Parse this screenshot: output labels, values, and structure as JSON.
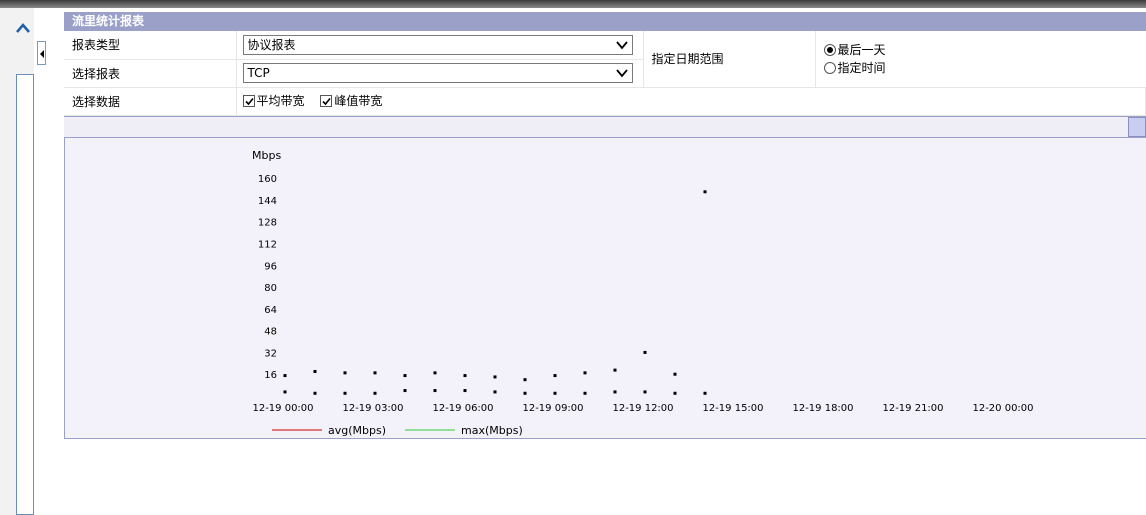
{
  "panel": {
    "title": "流里统计报表"
  },
  "form": {
    "report_type": {
      "label": "报表类型",
      "value": "协议报表"
    },
    "select_report": {
      "label": "选择报表",
      "value": "TCP"
    },
    "select_data": {
      "label": "选择数据",
      "options": [
        "平均带宽",
        "峰值带宽"
      ],
      "checked": [
        true,
        true
      ]
    },
    "date_range": {
      "label": "指定日期范围",
      "options": [
        "最后一天",
        "指定时间"
      ],
      "selected": "最后一天"
    }
  },
  "chart_data": {
    "type": "scatter",
    "ylabel": "Mbps",
    "yticks": [
      16,
      32,
      48,
      64,
      80,
      96,
      112,
      128,
      144,
      160
    ],
    "ylim": [
      0,
      166
    ],
    "xticks": [
      "12-19 00:00",
      "12-19 03:00",
      "12-19 06:00",
      "12-19 09:00",
      "12-19 12:00",
      "12-19 15:00",
      "12-19 18:00",
      "12-19 21:00",
      "12-20 00:00"
    ],
    "x_unit": "hours from 12-19 00:00",
    "xlim": [
      0,
      24
    ],
    "series": [
      {
        "name": "avg(Mbps)",
        "color": "#cc0000",
        "points": [
          [
            0,
            3
          ],
          [
            1,
            2
          ],
          [
            2,
            2
          ],
          [
            3,
            2
          ],
          [
            4,
            4
          ],
          [
            5,
            4
          ],
          [
            6,
            4
          ],
          [
            7,
            3
          ],
          [
            8,
            2
          ],
          [
            9,
            2
          ],
          [
            10,
            2
          ],
          [
            11,
            3
          ],
          [
            12,
            3
          ],
          [
            13,
            2
          ],
          [
            14,
            2
          ]
        ]
      },
      {
        "name": "max(Mbps)",
        "color": "#33cc33",
        "points": [
          [
            0,
            15
          ],
          [
            1,
            18
          ],
          [
            2,
            17
          ],
          [
            3,
            17
          ],
          [
            4,
            15
          ],
          [
            5,
            17
          ],
          [
            6,
            15
          ],
          [
            7,
            14
          ],
          [
            8,
            12
          ],
          [
            9,
            15
          ],
          [
            10,
            17
          ],
          [
            11,
            19
          ],
          [
            12,
            32
          ],
          [
            13,
            16
          ],
          [
            14,
            150
          ]
        ]
      }
    ],
    "legend_position": "bottom",
    "grid": false
  }
}
